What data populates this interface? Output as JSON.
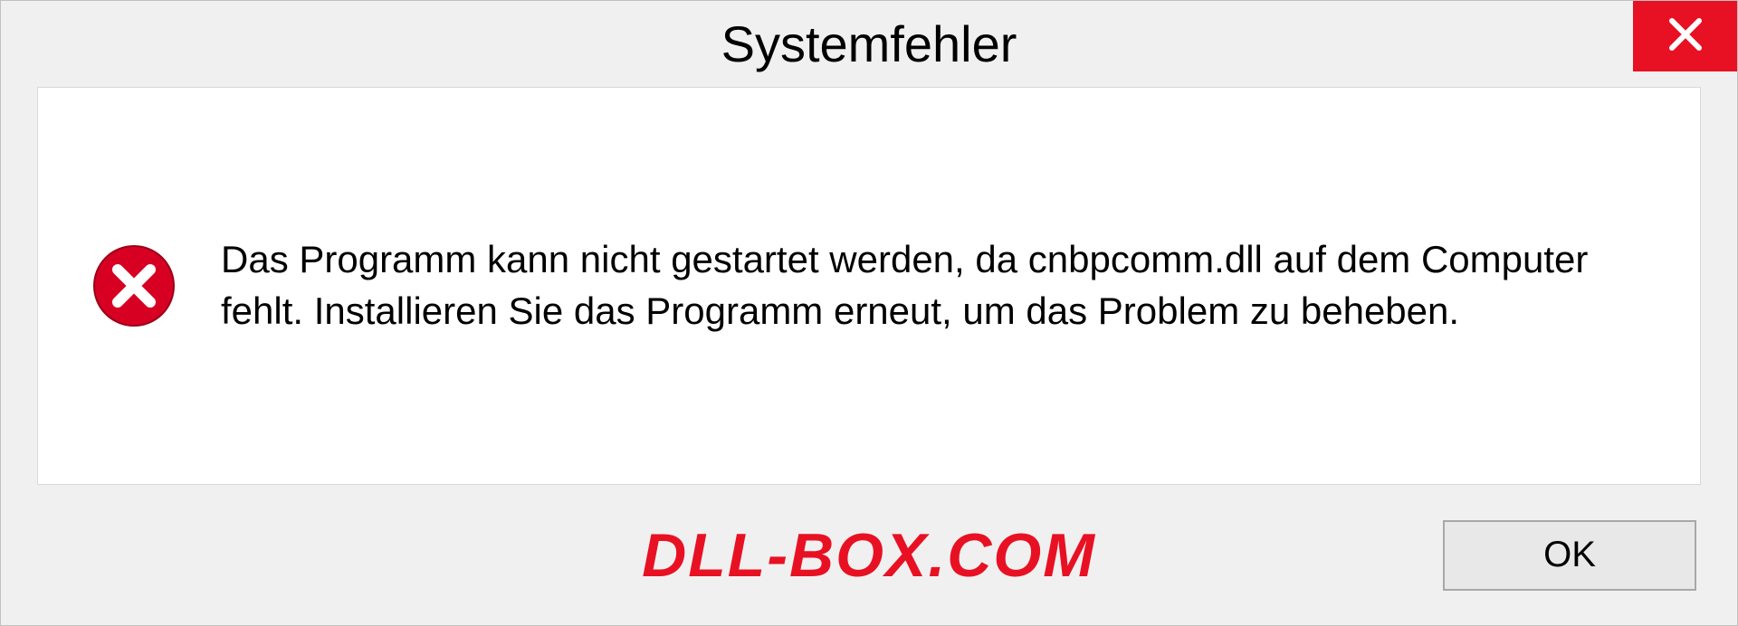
{
  "titlebar": {
    "title": "Systemfehler"
  },
  "content": {
    "message": "Das Programm kann nicht gestartet werden, da cnbpcomm.dll auf dem Computer fehlt. Installieren Sie das Programm erneut, um das Problem zu beheben."
  },
  "footer": {
    "watermark": "DLL-BOX.COM",
    "ok_label": "OK"
  }
}
